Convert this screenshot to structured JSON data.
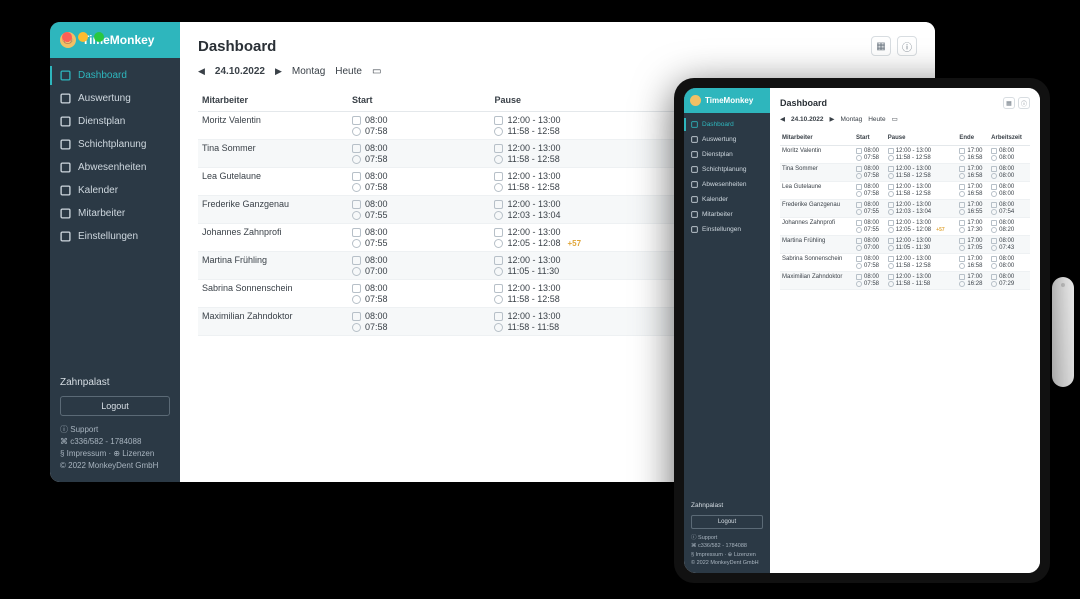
{
  "brand": "TimeMonkey",
  "pageTitle": "Dashboard",
  "date": "24.10.2022",
  "weekday": "Montag",
  "today": "Heute",
  "org": "Zahnpalast",
  "logout": "Logout",
  "nav": [
    {
      "k": "dashboard",
      "label": "Dashboard",
      "active": true
    },
    {
      "k": "auswertung",
      "label": "Auswertung"
    },
    {
      "k": "dienstplan",
      "label": "Dienstplan"
    },
    {
      "k": "schichtplanung",
      "label": "Schichtplanung"
    },
    {
      "k": "abwesenheiten",
      "label": "Abwesenheiten"
    },
    {
      "k": "kalender",
      "label": "Kalender"
    },
    {
      "k": "mitarbeiter",
      "label": "Mitarbeiter"
    },
    {
      "k": "einstellungen",
      "label": "Einstellungen"
    }
  ],
  "footer": {
    "support": "Support",
    "version": "c336/582 - 1784088",
    "imp": "Impressum",
    "lic": "Lizenzen",
    "copy": "© 2022 MonkeyDent GmbH"
  },
  "cols": {
    "mitarbeiter": "Mitarbeiter",
    "start": "Start",
    "pause": "Pause",
    "ende": "Ende",
    "arbeitszeit": "Arbeitszeit"
  },
  "rows": [
    {
      "name": "Moritz Valentin",
      "startPlan": "08:00",
      "startAct": "07:58",
      "pausePlan": "12:00 - 13:00",
      "pauseAct": "11:58 - 12:58",
      "endPlan": "17:00",
      "endAct": "16:58",
      "workPlan": "08:00",
      "workAct": "08:00"
    },
    {
      "name": "Tina Sommer",
      "startPlan": "08:00",
      "startAct": "07:58",
      "pausePlan": "12:00 - 13:00",
      "pauseAct": "11:58 - 12:58",
      "endPlan": "17:00",
      "endAct": "16:58",
      "workPlan": "08:00",
      "workAct": "08:00"
    },
    {
      "name": "Lea Gutelaune",
      "startPlan": "08:00",
      "startAct": "07:58",
      "pausePlan": "12:00 - 13:00",
      "pauseAct": "11:58 - 12:58",
      "endPlan": "17:00",
      "endAct": "16:58",
      "workPlan": "08:00",
      "workAct": "08:00"
    },
    {
      "name": "Frederike Ganzgenau",
      "startPlan": "08:00",
      "startAct": "07:55",
      "pausePlan": "12:00 - 13:00",
      "pauseAct": "12:03 - 13:04",
      "endPlan": "17:00",
      "endAct": "16:55",
      "workPlan": "08:00",
      "workAct": "07:54"
    },
    {
      "name": "Johannes Zahnprofi",
      "startPlan": "08:00",
      "startAct": "07:55",
      "pausePlan": "12:00 - 13:00",
      "pauseAct": "12:05 - 12:08",
      "pauseBadge": "+57",
      "endPlan": "17:00",
      "endAct": "17:30",
      "workPlan": "08:00",
      "workAct": "08:20"
    },
    {
      "name": "Martina Frühling",
      "startPlan": "08:00",
      "startAct": "07:00",
      "pausePlan": "12:00 - 13:00",
      "pauseAct": "11:05 - 11:30",
      "endPlan": "17:00",
      "endAct": "17:05",
      "workPlan": "08:00",
      "workAct": "07:43"
    },
    {
      "name": "Sabrina Sonnenschein",
      "startPlan": "08:00",
      "startAct": "07:58",
      "pausePlan": "12:00 - 13:00",
      "pauseAct": "11:58 - 12:58",
      "endPlan": "17:00",
      "endAct": "16:58",
      "workPlan": "08:00",
      "workAct": "08:00"
    },
    {
      "name": "Maximilian Zahndoktor",
      "startPlan": "08:00",
      "startAct": "07:58",
      "pausePlan": "12:00 - 13:00",
      "pauseAct": "11:58 - 11:58",
      "endPlan": "17:00",
      "endAct": "16:28",
      "workPlan": "08:00",
      "workAct": "07:29"
    }
  ]
}
